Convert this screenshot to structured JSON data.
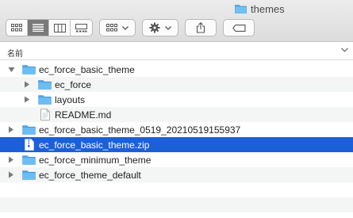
{
  "window": {
    "title": "themes"
  },
  "toolbar": {
    "view_buttons": [
      "icon-view",
      "list-view",
      "column-view",
      "gallery-view"
    ],
    "active_view": 1,
    "group_button": "group-by",
    "action_button": "action-menu",
    "share_button": "share",
    "tag_button": "tags"
  },
  "columns": {
    "name_header": "名前"
  },
  "files": [
    {
      "label": "ec_force_basic_theme",
      "kind": "folder",
      "level": 0,
      "expanded": true
    },
    {
      "label": "ec_force",
      "kind": "folder",
      "level": 1,
      "expanded": false
    },
    {
      "label": "layouts",
      "kind": "folder",
      "level": 1,
      "expanded": false
    },
    {
      "label": "README.md",
      "kind": "file",
      "level": 1
    },
    {
      "label": "ec_force_basic_theme_0519_20210519155937",
      "kind": "folder",
      "level": 0,
      "expanded": false
    },
    {
      "label": "ec_force_basic_theme.zip",
      "kind": "zip",
      "level": 0,
      "selected": true
    },
    {
      "label": "ec_force_minimum_theme",
      "kind": "folder",
      "level": 0,
      "expanded": false
    },
    {
      "label": "ec_force_theme_default",
      "kind": "folder",
      "level": 0,
      "expanded": false
    }
  ],
  "colors": {
    "selection": "#1c60d8",
    "folder": "#5ab0ee"
  }
}
